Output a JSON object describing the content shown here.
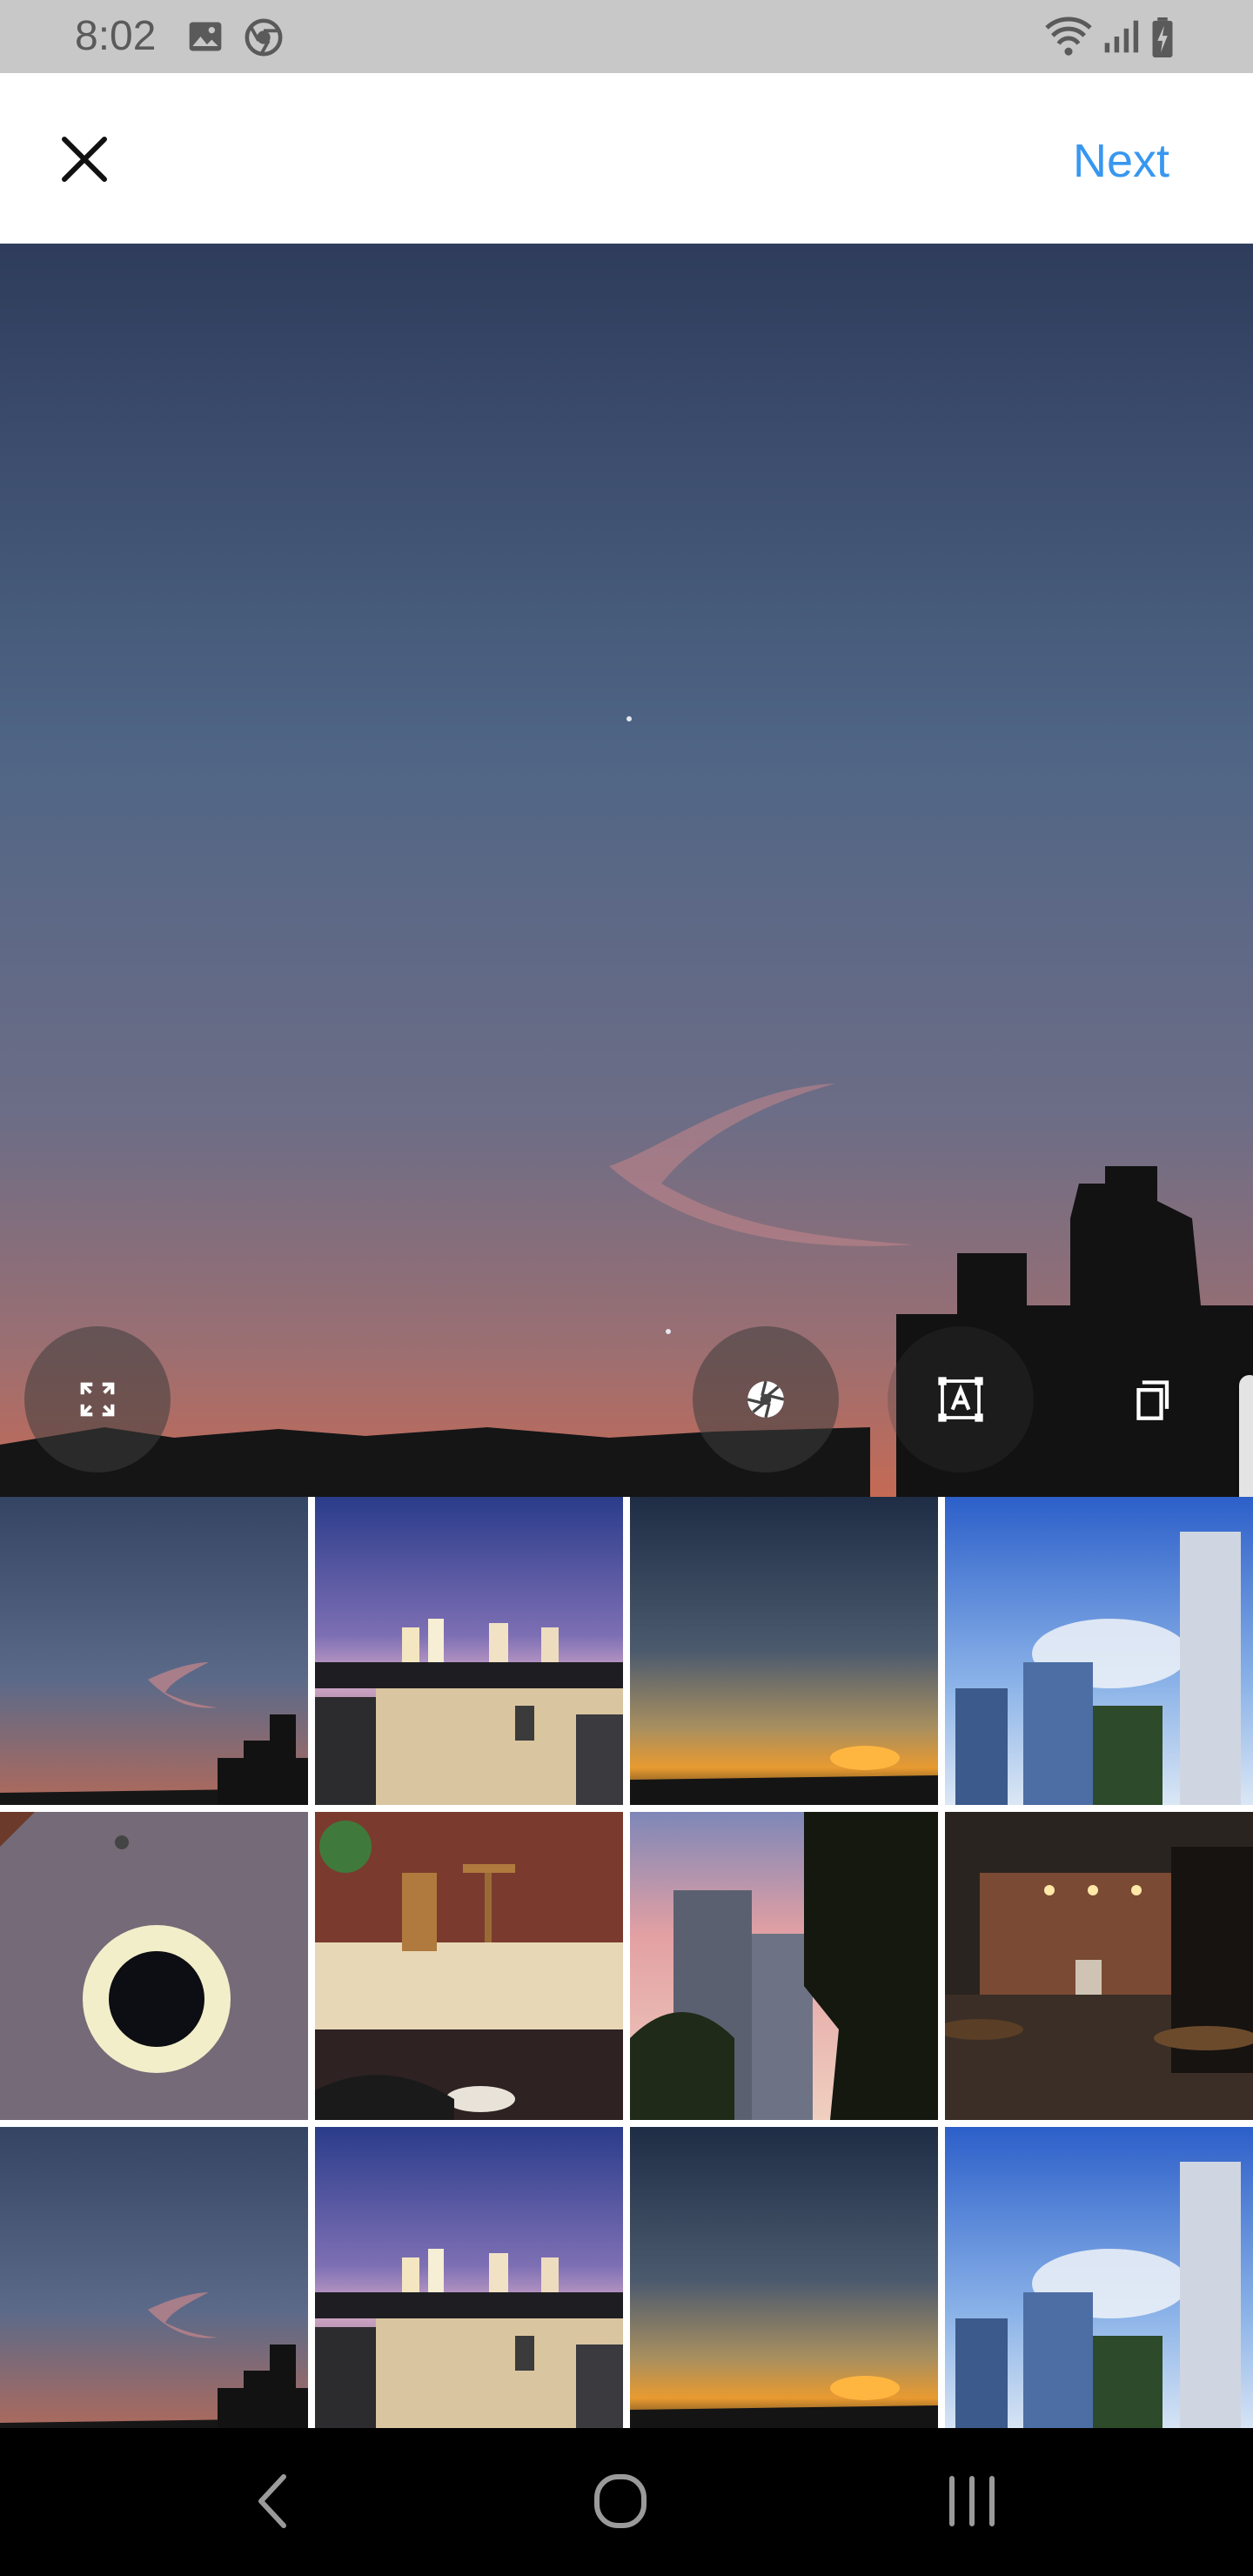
{
  "status_bar": {
    "time": "8:02",
    "left_icons": [
      "image-notification-icon",
      "chrome-notification-icon"
    ],
    "right_icons": [
      "wifi-icon",
      "signal-icon",
      "battery-charging-icon"
    ]
  },
  "top_bar": {
    "close_icon": "close-icon",
    "next_label": "Next",
    "accent_color": "#3897f0"
  },
  "preview": {
    "tools": [
      "expand-icon",
      "aperture-icon",
      "text-box-icon",
      "multi-select-icon"
    ]
  },
  "gallery": {
    "thumbnails": [
      "sunset-sky",
      "night-city-balcony",
      "sunset-horizon",
      "blue-sky-buildings",
      "coffee-cup",
      "cafe-chairs",
      "tower-trees-dusk",
      "restaurant-interior",
      "sunset-sky",
      "night-city-balcony",
      "sunset-horizon",
      "blue-sky-buildings"
    ]
  },
  "nav_bar": {
    "icons": [
      "back-icon",
      "home-icon",
      "recents-icon"
    ]
  }
}
